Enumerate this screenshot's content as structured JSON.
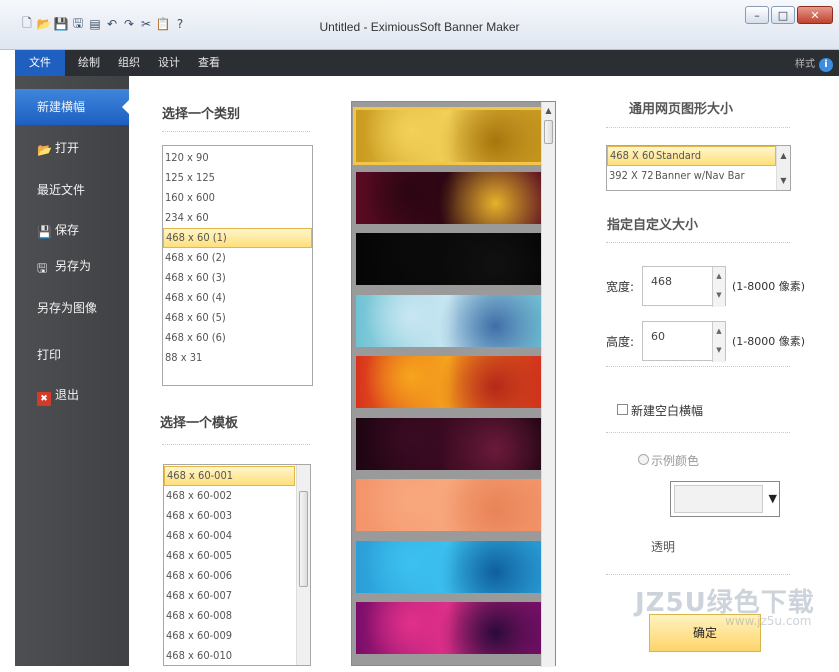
{
  "window": {
    "title": "Untitled - EximiousSoft Banner Maker",
    "minimize": "–",
    "maximize": "□",
    "close": "✕"
  },
  "quick_access": [
    "new-icon",
    "open-icon",
    "save-icon",
    "save-as-icon",
    "print-icon",
    "undo-icon",
    "redo-icon",
    "cut-icon",
    "paste-icon",
    "help-icon"
  ],
  "tabs": [
    {
      "label": "文件",
      "active": true
    },
    {
      "label": "绘制"
    },
    {
      "label": "组织"
    },
    {
      "label": "设计"
    },
    {
      "label": "查看"
    }
  ],
  "help_label": "样式",
  "nav": [
    {
      "label": "新建横幅",
      "active": true
    },
    {
      "label": "打开",
      "icon": "📂"
    },
    {
      "label": "最近文件"
    },
    {
      "label": "保存",
      "icon": "💾"
    },
    {
      "label": "另存为",
      "icon": "💾"
    },
    {
      "label": "另存为图像"
    },
    {
      "label": "打印"
    },
    {
      "label": "退出",
      "icon": "✖"
    }
  ],
  "category": {
    "heading": "选择一个类别",
    "items": [
      "120 x 90",
      "125 x 125",
      "160 x 600",
      "234 x 60",
      "468 x 60 (1)",
      "468 x 60 (2)",
      "468 x 60 (3)",
      "468 x 60 (4)",
      "468 x 60 (5)",
      "468 x 60 (6)",
      "88 x 31"
    ],
    "selected_index": 4
  },
  "template": {
    "heading": "选择一个模板",
    "items": [
      "468 x 60-001",
      "468 x 60-002",
      "468 x 60-003",
      "468 x 60-004",
      "468 x 60-005",
      "468 x 60-006",
      "468 x 60-007",
      "468 x 60-008",
      "468 x 60-009",
      "468 x 60-010"
    ],
    "selected_index": 0
  },
  "gallery": [
    {
      "colors": [
        "#c89a1e",
        "#f3d25a",
        "#a8750c"
      ]
    },
    {
      "colors": [
        "#5a0a22",
        "#2b0612",
        "#e7b22c"
      ]
    },
    {
      "colors": [
        "#050505",
        "#0a0a0a",
        "#111111"
      ]
    },
    {
      "colors": [
        "#6fc3d4",
        "#c9e7f2",
        "#3f6ea8"
      ]
    },
    {
      "colors": [
        "#d8321c",
        "#f6a51d",
        "#b5281a"
      ]
    },
    {
      "colors": [
        "#1e0512",
        "#3a0a22",
        "#6b1a3a"
      ]
    },
    {
      "colors": [
        "#f4946a",
        "#f8a77d",
        "#e88357"
      ]
    },
    {
      "colors": [
        "#2a9ed8",
        "#3cc1ef",
        "#0f5f9c"
      ]
    },
    {
      "colors": [
        "#7a0d6a",
        "#e2308a",
        "#2a0a3a"
      ]
    }
  ],
  "right": {
    "std_size_heading": "通用网页图形大小",
    "std_sizes": [
      {
        "size": "468 X 60",
        "name": "Standard",
        "selected": true
      },
      {
        "size": "392 X 72",
        "name": "Banner w/Nav Bar"
      }
    ],
    "custom_heading": "指定自定义大小",
    "width_label": "宽度:",
    "width_value": "468",
    "height_label": "高度:",
    "height_value": "60",
    "range_text": "(1-8000 像素)",
    "blank_label": "新建空白横幅",
    "color_label": "示例颜色",
    "transparent_label": "透明",
    "ok_label": "确定"
  },
  "watermark": {
    "big": "JZ5U绿色下载",
    "small": "www.jz5u.com"
  }
}
